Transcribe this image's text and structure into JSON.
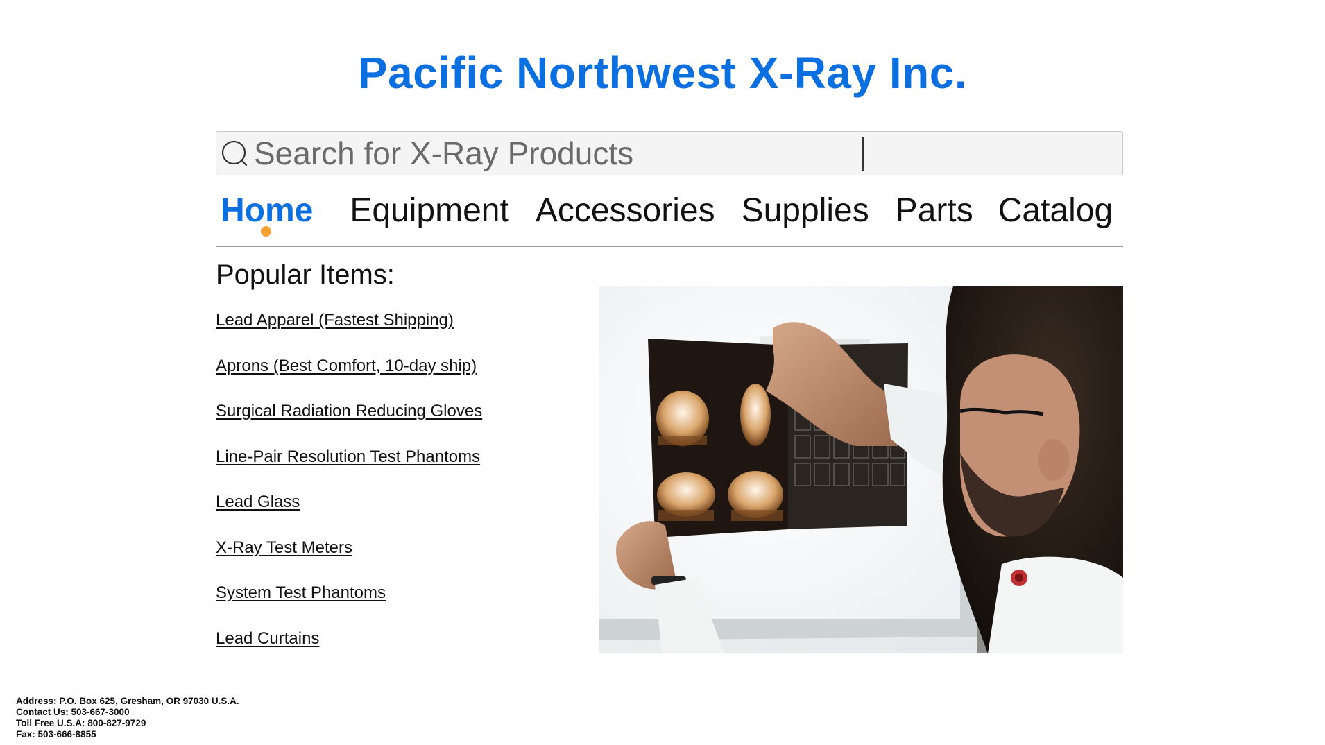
{
  "site": {
    "title": "Pacific Northwest X-Ray Inc."
  },
  "search": {
    "placeholder": "Search for X-Ray Products",
    "value": "",
    "icon": "search-icon"
  },
  "nav": {
    "items": [
      {
        "label": "Home",
        "active": true
      },
      {
        "label": "Equipment",
        "active": false
      },
      {
        "label": "Accessories",
        "active": false
      },
      {
        "label": "Supplies",
        "active": false
      },
      {
        "label": "Parts",
        "active": false
      },
      {
        "label": "Catalog",
        "active": false
      }
    ]
  },
  "popular": {
    "title": "Popular Items:",
    "items": [
      "Lead Apparel (Fastest Shipping)",
      "Aprons (Best Comfort, 10-day ship)",
      "Surgical Radiation Reducing Gloves",
      "Line-Pair Resolution Test Phantoms",
      "Lead Glass",
      "X-Ray Test Meters",
      "System Test Phantoms",
      "Lead Curtains"
    ]
  },
  "footer": {
    "address": "Address: P.O. Box 625, Gresham, OR 97030 U.S.A.",
    "contact": "Contact Us: 503-667-3000",
    "toll_free": "Toll Free U.S.A: 800-827-9729",
    "fax": "Fax: 503-666-8855"
  },
  "colors": {
    "brand": "#0b6fe0",
    "active_dot": "#f5a030"
  }
}
